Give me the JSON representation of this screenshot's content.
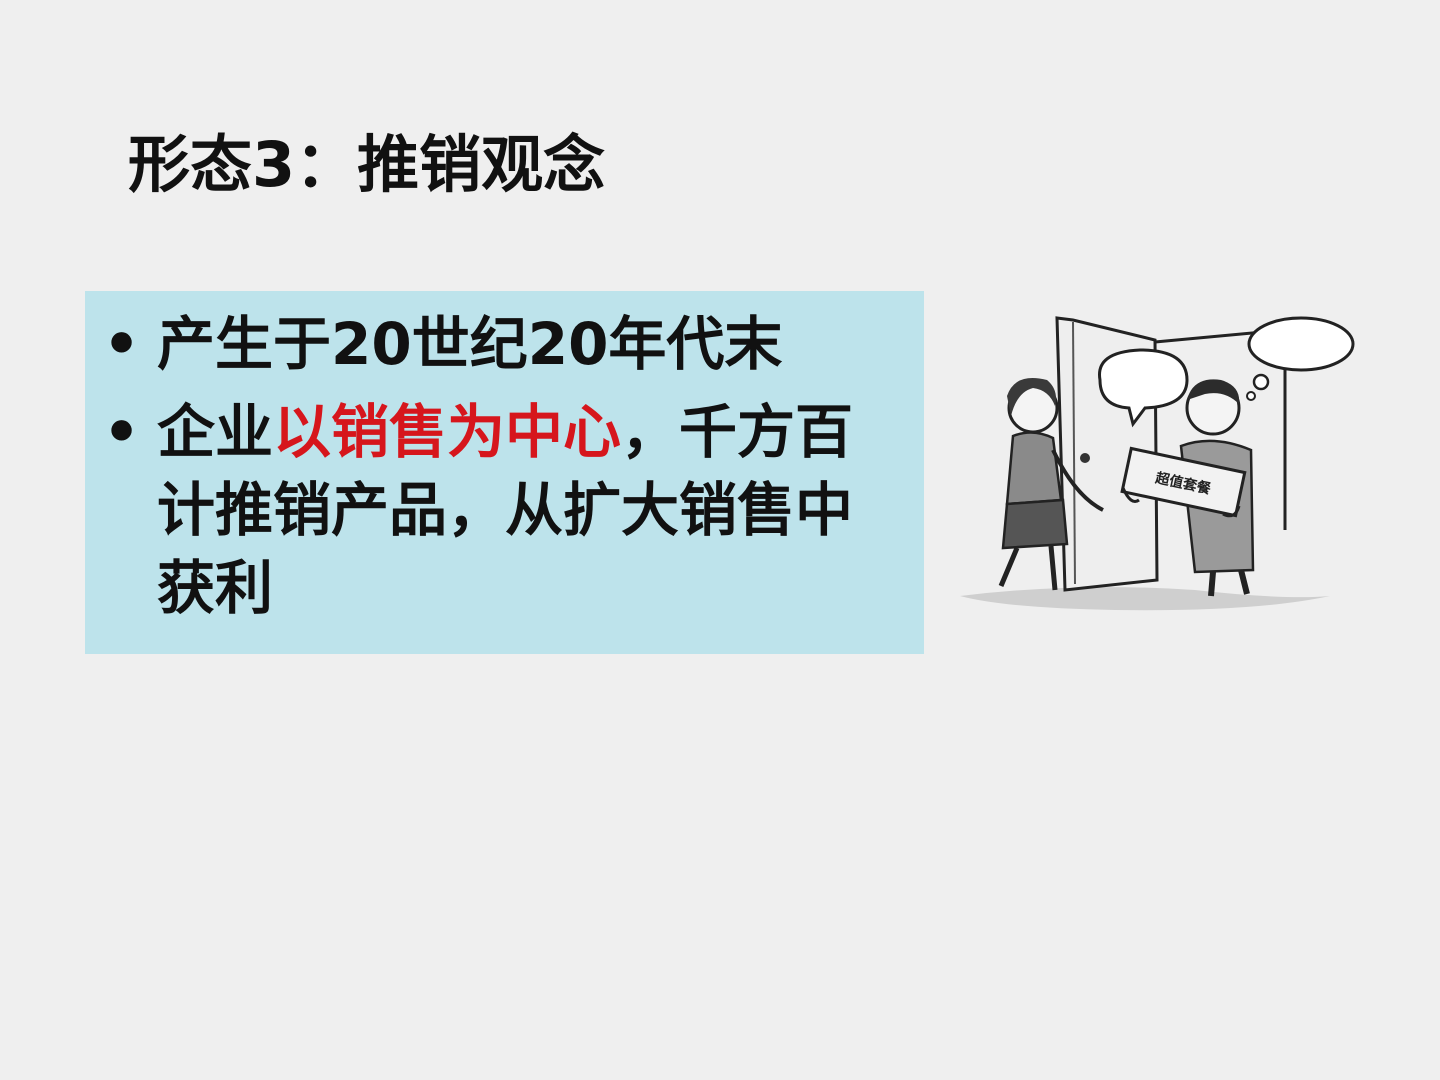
{
  "slide": {
    "title": "形态3：推销观念"
  },
  "content": {
    "bullets": [
      {
        "marker": "•",
        "text": "产生于20世纪20年代末"
      },
      {
        "marker": "•",
        "prefix": "企业",
        "highlight": "以销售为中心",
        "suffix": "，千方百计推销产品，从扩大销售中获利"
      }
    ],
    "highlight_color": "#d6161c",
    "box_color": "#bde3eb"
  },
  "illustration": {
    "box_label": "超值套餐"
  }
}
